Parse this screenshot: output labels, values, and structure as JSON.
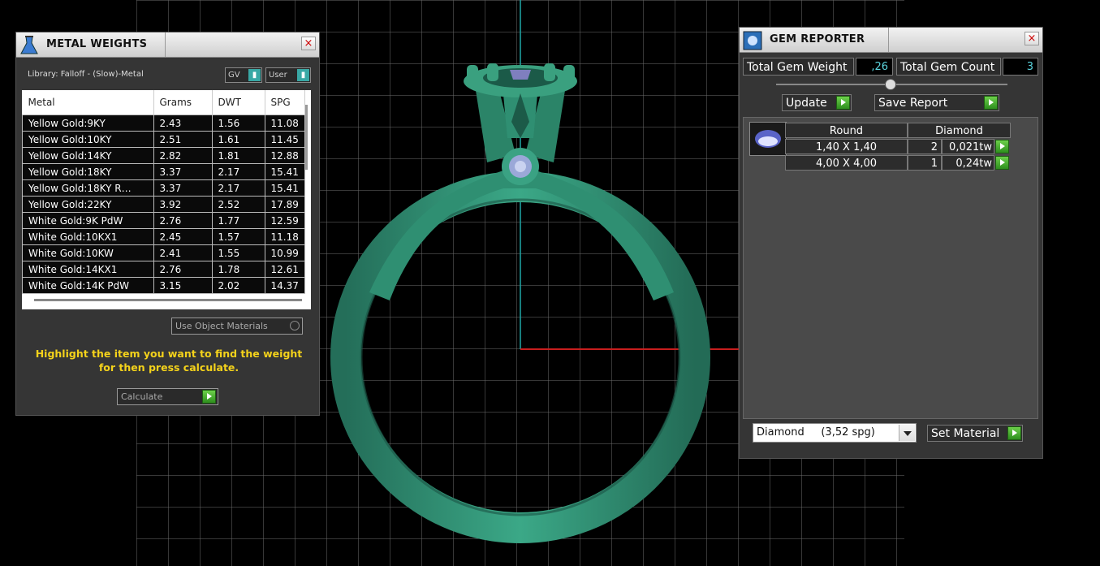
{
  "metal_weights": {
    "title": "METAL WEIGHTS",
    "close": "×",
    "library_label": "Library: Falloff - (Slow)-Metal",
    "gv_label": "GV",
    "user_label": "User",
    "columns": [
      "Metal",
      "Grams",
      "DWT",
      "SPG"
    ],
    "rows": [
      [
        "Yellow Gold:9KY",
        "2.43",
        "1.56",
        "11.08"
      ],
      [
        "Yellow Gold:10KY",
        "2.51",
        "1.61",
        "11.45"
      ],
      [
        "Yellow Gold:14KY",
        "2.82",
        "1.81",
        "12.88"
      ],
      [
        "Yellow Gold:18KY",
        "3.37",
        "2.17",
        "15.41"
      ],
      [
        "Yellow Gold:18KY R…",
        "3.37",
        "2.17",
        "15.41"
      ],
      [
        "Yellow Gold:22KY",
        "3.92",
        "2.52",
        "17.89"
      ],
      [
        "White Gold:9K PdW",
        "2.76",
        "1.77",
        "12.59"
      ],
      [
        "White Gold:10KX1",
        "2.45",
        "1.57",
        "11.18"
      ],
      [
        "White Gold:10KW",
        "2.41",
        "1.55",
        "10.99"
      ],
      [
        "White Gold:14KX1",
        "2.76",
        "1.78",
        "12.61"
      ],
      [
        "White Gold:14K PdW",
        "3.15",
        "2.02",
        "14.37"
      ]
    ],
    "use_object_materials": "Use Object Materials",
    "hint_line1": "Highlight the item you want to find the weight",
    "hint_line2": "for then press calculate.",
    "calculate": "Calculate"
  },
  "gem_reporter": {
    "title": "GEM REPORTER",
    "close": "×",
    "total_weight_label": "Total Gem Weight",
    "total_weight_value": ",26",
    "total_count_label": "Total Gem Count",
    "total_count_value": "3",
    "update": "Update",
    "save_report": "Save Report",
    "headers": [
      "Round",
      "Diamond"
    ],
    "gems": [
      {
        "size": "1,40 X 1,40",
        "count": "2",
        "weight": "0,021tw"
      },
      {
        "size": "4,00 X 4,00",
        "count": "1",
        "weight": "0,24tw"
      }
    ],
    "material_select": "Diamond     (3,52 spg)",
    "set_material": "Set Material"
  },
  "colors": {
    "ring": "#2f8f72",
    "axis_vertical": "#1fa7a7",
    "axis_horizontal": "#c81e1e",
    "hint": "#f4d21b"
  }
}
